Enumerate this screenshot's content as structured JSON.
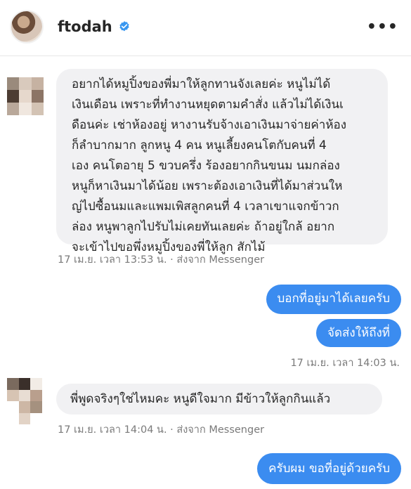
{
  "header": {
    "username": "ftodah",
    "more_label": "•••"
  },
  "colors": {
    "outgoing_bubble": "#3b8cf0",
    "incoming_bubble": "#f1f1f3",
    "verified_badge": "#3897f0"
  },
  "messages": [
    {
      "direction": "incoming",
      "lines": [
        "อยากได้หมูปิ้งของพี่มาให้ลูกทานจังเลยค่ะ หนูไม่ได้",
        "เงินเดือน เพราะที่ทำงานหยุดตามคำสั่ง แล้วไม่ได้เงินเ",
        "ดือนค่ะ เช่าห้องอยู่ หางานรับจ้างเอาเงินมาจ่ายค่าห้อง",
        "ก็ลำบากมาก  ลูกหนู 4 คน หนูเลี้ยงคนโตกับคนที่ 4",
        "เอง คนโตอายุ 5 ขวบครึ่ง ร้องอยากกินขนม นมกล่อง",
        "หนูก็หาเงินมาได้น้อย เพราะต้องเอาเงินที่ได้มาส่วนให",
        "ญ่ไปซื้อนมและแพมเพิสลูกคนที่ 4  เวลาเขาแจกข้าวก",
        "ล่อง หนูพาลูกไปรับไม่เคยทันเลยค่ะ ถ้าอยู่ใกล้ อยาก",
        "จะเข้าไปขอพึ่งหมูปิ้งของพี่ให้ลูก สักไม้"
      ],
      "meta": "17 เม.ย. เวลา 13:53 น. · ส่งจาก Messenger"
    },
    {
      "direction": "outgoing",
      "text": "บอกที่อยู่มาได้เลยครับ"
    },
    {
      "direction": "outgoing",
      "text": "จัดส่งให้ถึงที่",
      "meta": "17 เม.ย. เวลา 14:03 น."
    },
    {
      "direction": "incoming",
      "text": "พี่พูดจริงๆใช่ไหมคะ หนูดีใจมาก มีข้าวให้ลูกกินแล้ว",
      "meta": "17 เม.ย. เวลา 14:04 น. · ส่งจาก Messenger"
    },
    {
      "direction": "outgoing",
      "text": "ครับผม ขอที่อยู่ด้วยครับ"
    }
  ]
}
